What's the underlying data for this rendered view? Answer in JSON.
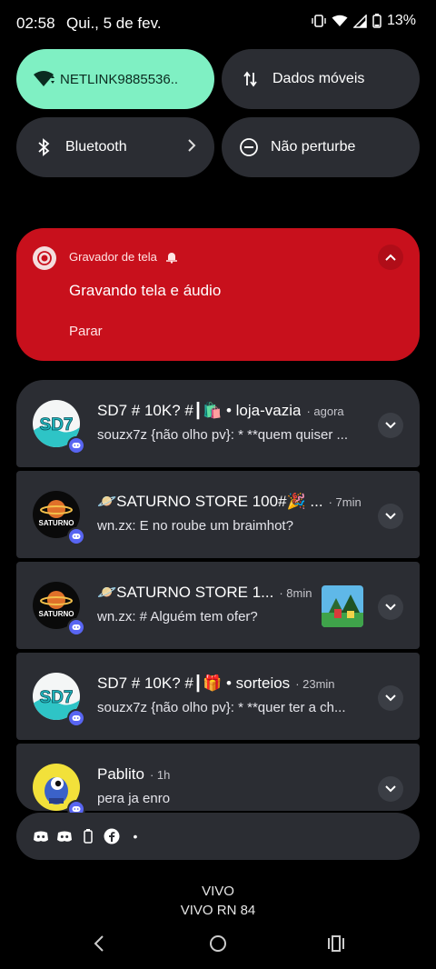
{
  "status_bar": {
    "time": "02:58",
    "date": "Qui., 5 de fev.",
    "battery": "13%"
  },
  "quick_settings": {
    "wifi_label": "NETLINK9885536..",
    "mobile_data_label": "Dados móveis",
    "bluetooth_label": "Bluetooth",
    "dnd_label": "Não perturbe"
  },
  "recorder": {
    "app_name": "Gravador de tela",
    "title": "Gravando tela e áudio",
    "stop_label": "Parar"
  },
  "notifications": [
    {
      "title": "SD7 # 10K? #┃🛍️ • loja-vazia",
      "time": "· agora",
      "body": "souzx7z {não olho pv}: * **quem quiser ..."
    },
    {
      "title": "🪐SATURNO STORE 100#🎉 ...",
      "time": "· 7min",
      "body": "wn.zx: E no roube um braimhot?"
    },
    {
      "title": "🪐SATURNO STORE 1...",
      "time": "· 8min",
      "body": "wn.zx: # Alguém tem ofer?"
    },
    {
      "title": "SD7 # 10K? #┃🎁 • sorteios",
      "time": "· 23min",
      "body": "souzx7z {não olho pv}: * **quer ter a ch..."
    },
    {
      "title": "Pablito",
      "time": "· 1h",
      "body": "pera ja enro"
    }
  ],
  "avatars": {
    "sd7": "SD7",
    "saturno": "SATURNO"
  },
  "silent_dot": "•",
  "carrier": {
    "line1": "VIVO",
    "line2": "VIVO RN 84"
  },
  "colors": {
    "accent_mint": "#7ff0c3",
    "recorder_red": "#c8101c",
    "card_bg": "#2b2d33"
  }
}
